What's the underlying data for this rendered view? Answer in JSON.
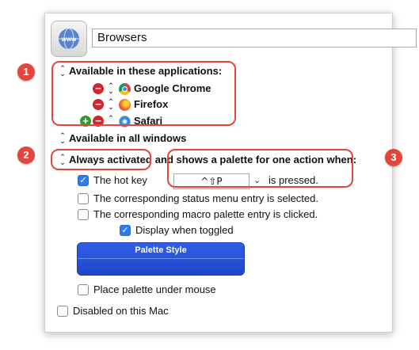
{
  "macro_group": {
    "name": "Browsers",
    "icon": "www-globe-icon"
  },
  "availability": {
    "mode_label": "Available in these applications:",
    "apps": [
      {
        "name": "Google Chrome",
        "icon": "chrome-icon"
      },
      {
        "name": "Firefox",
        "icon": "firefox-icon"
      },
      {
        "name": "Safari",
        "icon": "safari-icon"
      }
    ],
    "windows_label": "Available in all windows"
  },
  "activation": {
    "mode_label": "Always activated",
    "suffix": "and shows a palette for one action when:",
    "hot_key_label": "The hot key",
    "hot_key_value": "^⇧P",
    "hot_key_suffix": "is pressed.",
    "status_menu_label": "The corresponding status menu entry is selected.",
    "macro_palette_label": "The corresponding macro palette entry is clicked.",
    "display_when_toggled_label": "Display when toggled",
    "checks": {
      "hot_key": true,
      "status_menu": false,
      "macro_palette": false,
      "display_when_toggled": true
    }
  },
  "palette": {
    "style_label": "Palette Style",
    "place_under_mouse_label": "Place palette under mouse",
    "place_under_mouse": false
  },
  "disabled_label": "Disabled on this Mac",
  "callouts": [
    "1",
    "2",
    "3"
  ],
  "colors": {
    "callout": "#e5453c",
    "accent": "#2f7be8",
    "palette": "#2e60e6"
  }
}
